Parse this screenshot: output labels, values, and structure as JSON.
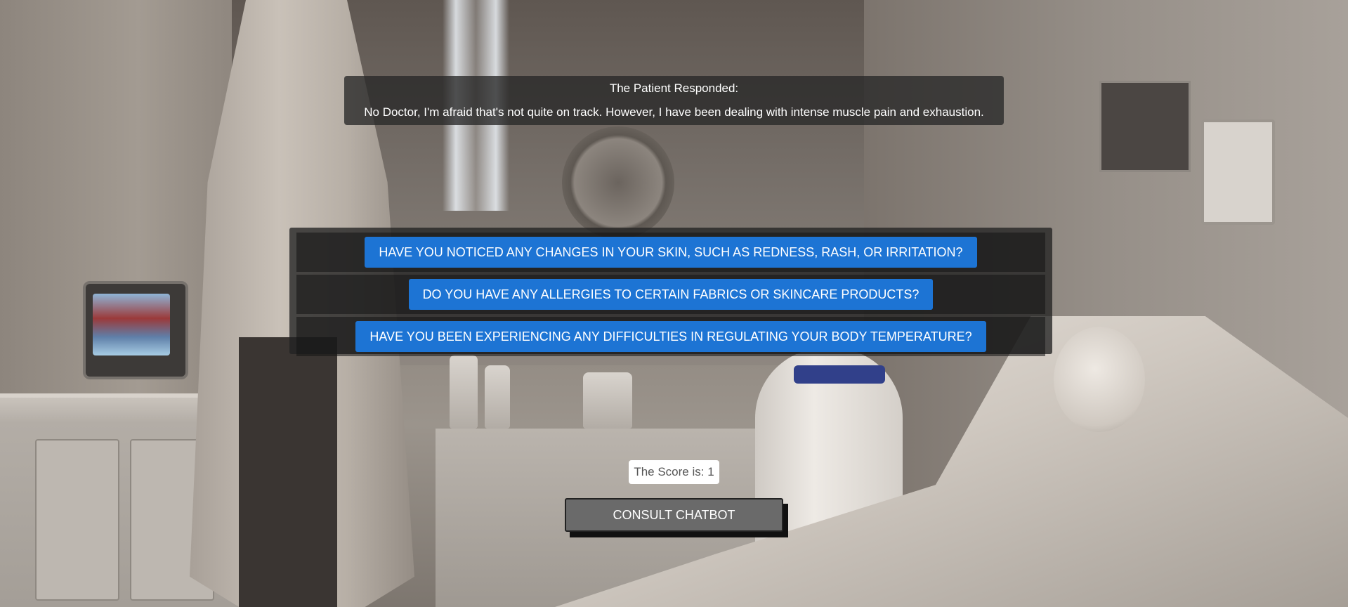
{
  "response": {
    "title": "The Patient Responded:",
    "text": "No Doctor, I'm afraid that's not quite on track. However, I have been dealing with intense muscle pain and exhaustion."
  },
  "questions": [
    {
      "label": "HAVE YOU NOTICED ANY CHANGES IN YOUR SKIN, SUCH AS REDNESS, RASH, OR IRRITATION?"
    },
    {
      "label": "DO YOU HAVE ANY ALLERGIES TO CERTAIN FABRICS OR SKINCARE PRODUCTS?"
    },
    {
      "label": "HAVE YOU BEEN EXPERIENCING ANY DIFFICULTIES IN REGULATING YOUR BODY TEMPERATURE?"
    }
  ],
  "score": {
    "label": "The Score is: 1"
  },
  "consult": {
    "label": "CONSULT CHATBOT"
  },
  "colors": {
    "question_button": "#1d74d4",
    "consult_button": "#6a6a6a"
  }
}
